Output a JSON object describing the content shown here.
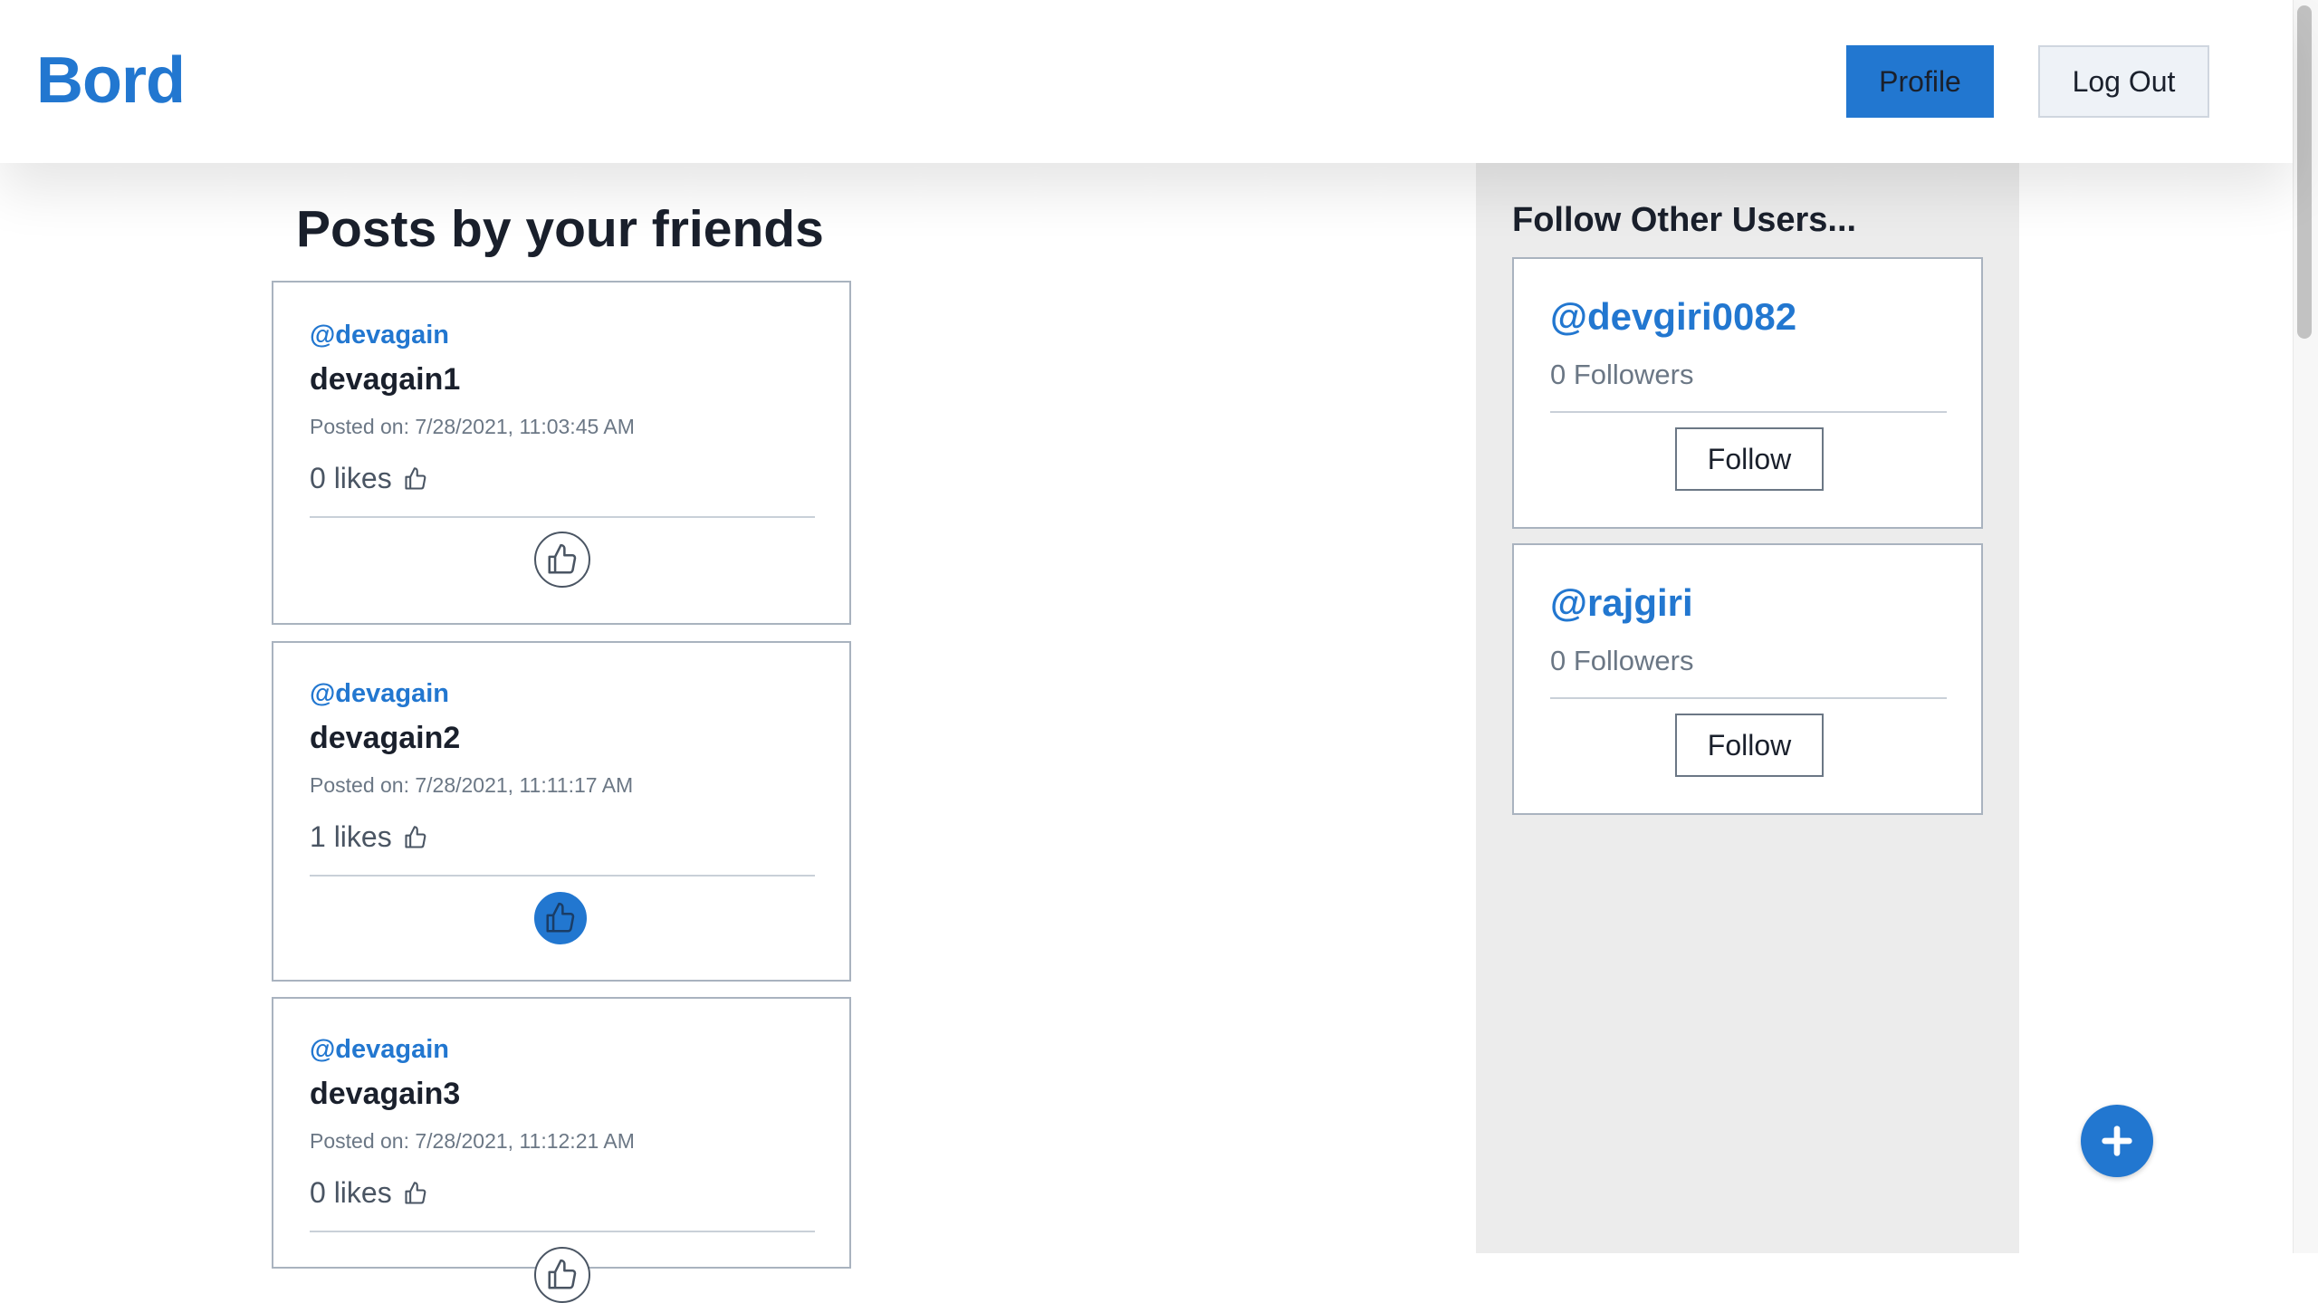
{
  "header": {
    "brand": "Bord",
    "profile_label": "Profile",
    "logout_label": "Log Out"
  },
  "feed": {
    "title": "Posts by your friends",
    "posts": [
      {
        "author": "@devagain",
        "title": "devagain1",
        "posted": "Posted on: 7/28/2021, 11:03:45 AM",
        "likes": "0 likes",
        "liked": false
      },
      {
        "author": "@devagain",
        "title": "devagain2",
        "posted": "Posted on: 7/28/2021, 11:11:17 AM",
        "likes": "1 likes",
        "liked": true
      },
      {
        "author": "@devagain",
        "title": "devagain3",
        "posted": "Posted on: 7/28/2021, 11:12:21 AM",
        "likes": "0 likes",
        "liked": false
      }
    ]
  },
  "sidebar": {
    "title": "Follow Other Users...",
    "users": [
      {
        "handle": "@devgiri0082",
        "followers": "0 Followers",
        "follow_label": "Follow"
      },
      {
        "handle": "@rajgiri",
        "followers": "0 Followers",
        "follow_label": "Follow"
      }
    ]
  },
  "icons": {
    "like": "thumbs-up-icon",
    "add": "plus-icon"
  },
  "colors": {
    "accent": "#2277d0",
    "sidebar_bg": "#ececec"
  }
}
